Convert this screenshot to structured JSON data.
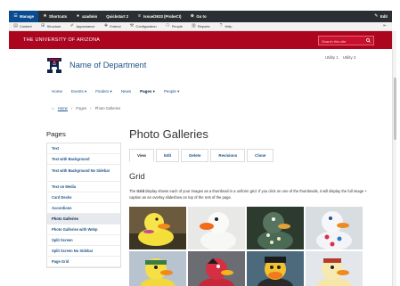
{
  "toolbar": {
    "manage": "Manage",
    "shortcuts": "Shortcuts",
    "user": "azadmin",
    "quickstart": "Quickstart 2",
    "issue": "Issue/2633 (ProbeCI)",
    "goto": "Go to",
    "edit": "Edit"
  },
  "admin_menu": {
    "items": [
      "Content",
      "Structure",
      "Appearance",
      "Extend",
      "Configuration",
      "People",
      "Reports",
      "Help"
    ]
  },
  "banner": {
    "university": "THE UNIVERSITY OF ARIZONA",
    "search_placeholder": "Search this site"
  },
  "header": {
    "department": "Name of Department",
    "utility": [
      "Utility 1",
      "Utility 2"
    ]
  },
  "nav": {
    "items": [
      "Home",
      "Events ▾",
      "Finders ▾",
      "News",
      "Pages ▾",
      "People ▾"
    ]
  },
  "breadcrumb": {
    "home": "Home",
    "items": [
      "Pages",
      "Photo Galleries"
    ]
  },
  "sidebar": {
    "heading": "Pages",
    "items": [
      "Text",
      "Text with Background",
      "Text with Background No Sidebar",
      "Text on Media",
      "Card Decks",
      "Accordions",
      "Photo Galleries",
      "Photo Galleries with Webp",
      "Split Screen",
      "Split Screen No Sidebar",
      "Page Grid"
    ]
  },
  "main": {
    "title": "Photo Galleries",
    "tabs": [
      "View",
      "Edit",
      "Delete",
      "Revisions",
      "Clone"
    ],
    "section_heading": "Grid",
    "description_bold": "Grid",
    "description_pre": "The ",
    "description_post": " display shows each of your images as a thumbnail in a uniform grid. If you click on one of the thumbnails, it will display the full image + caption as an overlay slideshow on top of the rest of the page."
  },
  "colors": {
    "brand_red": "#ab0520",
    "brand_navy": "#0c234b",
    "link_blue": "#1e5288",
    "toolbar_dark": "#2b2f33",
    "toolbar_blue": "#0b4b8f"
  },
  "icons": [
    "hamburger-icon",
    "star-icon",
    "user-icon",
    "shortcut-icon",
    "bars-icon",
    "link-icon",
    "pencil-icon",
    "search-icon",
    "university-a-logo"
  ]
}
